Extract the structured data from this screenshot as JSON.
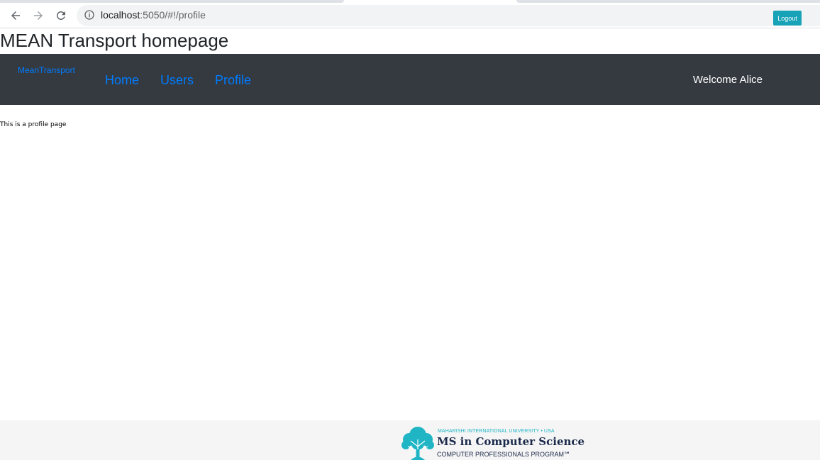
{
  "browser": {
    "url_host": "localhost",
    "url_path": ":5050/#!/profile"
  },
  "page": {
    "title": "MEAN Transport homepage"
  },
  "navbar": {
    "brand": "MeanTransport",
    "links": [
      {
        "label": "Home"
      },
      {
        "label": "Users"
      },
      {
        "label": "Profile"
      }
    ],
    "welcome": "Welcome Alice",
    "logout_label": "Logout"
  },
  "content": {
    "text": "This is a profile page"
  },
  "footer": {
    "logo_line1": "MAHARISHI INTERNATIONAL UNIVERSITY • USA",
    "logo_line2": "MS in Computer Science",
    "logo_line3": "COMPUTER PROFESSIONALS PROGRAM℠"
  },
  "colors": {
    "navbar_bg": "#343a40",
    "link": "#007bff",
    "logout_bg": "#17a2b8",
    "footer_bg": "#f5f5f5"
  }
}
